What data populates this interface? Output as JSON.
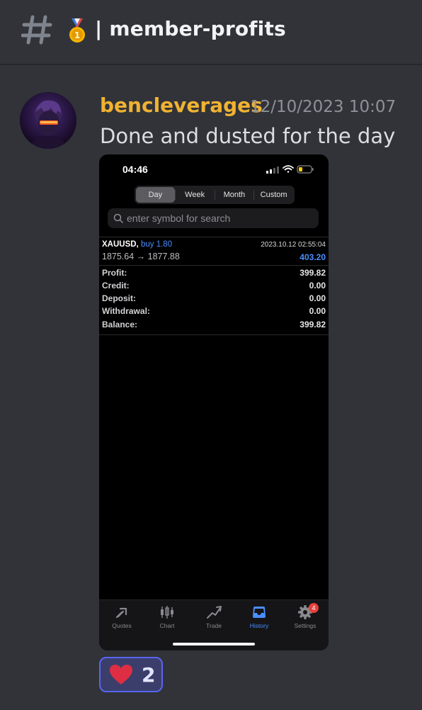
{
  "channel": {
    "name": "member-profits",
    "separator": "|",
    "emoji": "gold-medal-icon"
  },
  "message": {
    "author": "bencleverages",
    "timestamp": "12/10/2023 10:07",
    "text": "Done and dusted for the day",
    "author_color": "#f0b232"
  },
  "phone": {
    "status_time": "04:46",
    "tabs": [
      {
        "label": "Day",
        "active": true
      },
      {
        "label": "Week",
        "active": false
      },
      {
        "label": "Month",
        "active": false
      },
      {
        "label": "Custom",
        "active": false
      }
    ],
    "search_placeholder": "enter symbol for search",
    "deal": {
      "symbol": "XAUUSD,",
      "direction": "buy 1.80",
      "datetime": "2023.10.12 02:55:04",
      "prices": "1875.64 → 1877.88",
      "profit": "403.20"
    },
    "summary": [
      {
        "label": "Profit:",
        "value": "399.82"
      },
      {
        "label": "Credit:",
        "value": "0.00"
      },
      {
        "label": "Deposit:",
        "value": "0.00"
      },
      {
        "label": "Withdrawal:",
        "value": "0.00"
      },
      {
        "label": "Balance:",
        "value": "399.82"
      }
    ],
    "nav": [
      {
        "label": "Quotes",
        "icon": "quotes-icon"
      },
      {
        "label": "Chart",
        "icon": "candlestick-icon"
      },
      {
        "label": "Trade",
        "icon": "trade-icon"
      },
      {
        "label": "History",
        "icon": "inbox-icon",
        "active": true
      },
      {
        "label": "Settings",
        "icon": "gear-icon",
        "badge": "4"
      }
    ],
    "accent_color": "#4a8eff"
  },
  "reaction": {
    "emoji": "heart-icon",
    "count": "2"
  }
}
